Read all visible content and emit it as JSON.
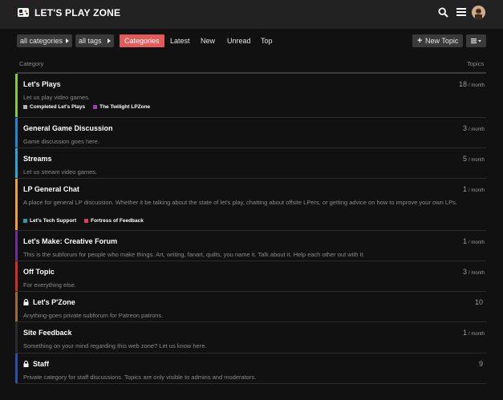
{
  "header": {
    "logo_text": "LET'S PLAY ZONE"
  },
  "nav": {
    "categories_filter": "all categories",
    "tags_filter": "all tags",
    "tabs": [
      {
        "label": "Categories"
      },
      {
        "label": "Latest"
      },
      {
        "label": "New"
      },
      {
        "label": "Unread"
      },
      {
        "label": "Top"
      }
    ],
    "new_topic_label": "New Topic"
  },
  "table": {
    "col_category": "Category",
    "col_topics": "Topics"
  },
  "categories": [
    {
      "title": "Let's Plays",
      "description": "Let us play video games.",
      "count": "18",
      "per": "/ month",
      "color": "#8cc63f",
      "subcategories": [
        {
          "label": "Completed Let's Plays",
          "color": "#b3b3b3"
        },
        {
          "label": "The Twilight LPZone",
          "color": "#9e3bb5"
        }
      ]
    },
    {
      "title": "General Game Discussion",
      "description": "Game discussion goes here.",
      "count": "3",
      "per": "/ month",
      "color": "#1e88d6"
    },
    {
      "title": "Streams",
      "description": "Let us stream video games.",
      "count": "5",
      "per": "/ month",
      "color": "#2aa7d9"
    },
    {
      "title": "LP General Chat",
      "description": "A place for general LP discussion. Whether it be talking about the state of let's play, chatting about offsite LPers, or getting advice on how to improve your own LPs.",
      "count": "1",
      "per": "/ month",
      "color": "#f39c33",
      "subcategories": [
        {
          "label": "Let's Tech Support",
          "color": "#1aa3a3"
        },
        {
          "label": "Fortress of Feedback",
          "color": "#e8395a"
        }
      ]
    },
    {
      "title": "Let's Make: Creative Forum",
      "description": "This is the subforum for people who make things. Art, writing, fanart, quilts, you name it. Talk about it. Help each other out with it.",
      "count": "1",
      "per": "/ month",
      "color": "#6b2fa3"
    },
    {
      "title": "Off Topic",
      "description": "For everything else.",
      "count": "3",
      "per": "/ month",
      "color": "#d42b2b"
    },
    {
      "title": "Let's P'Zone",
      "description": "Anything-goes private subforum for Patreon patrons.",
      "count": "10",
      "per": "",
      "color": "#9b6b3a",
      "locked": true
    },
    {
      "title": "Site Feedback",
      "description": "Something on your mind regarding this web zone? Let us know here.",
      "count": "1",
      "per": "/ month",
      "color": "#2b2b2b"
    },
    {
      "title": "Staff",
      "description": "Private category for staff discussions. Topics are only visible to admins and moderators.",
      "count": "9",
      "per": "",
      "color": "#2e4ea8",
      "locked": true
    }
  ]
}
